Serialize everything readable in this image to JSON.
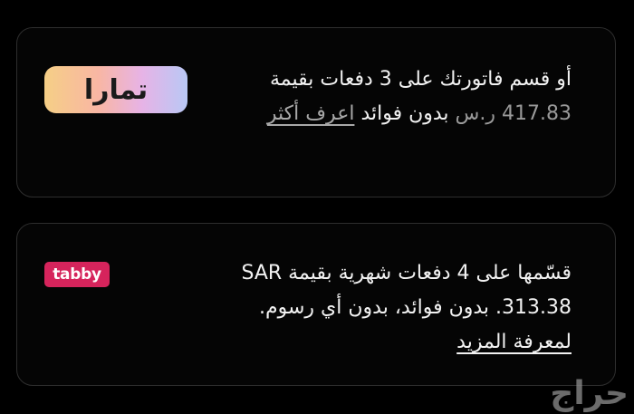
{
  "tamara": {
    "logo_text": "تمارا",
    "line1": "أو قسم فاتورتك على 3 دفعات بقيمة",
    "amount": "417.83 ر.س",
    "no_fees": "بدون فوائد",
    "learn_more": "اعرف أكثر"
  },
  "tabby": {
    "logo_text": "tabby",
    "line1": "قسّمها على 4 دفعات شهرية بقيمة SAR",
    "line2": "313.38. بدون فوائد، بدون أي رسوم.",
    "learn_more": "لمعرفة المزيد"
  },
  "watermark": {
    "text": "حراج"
  },
  "colors": {
    "background": "#000000",
    "card_border": "#2e2e2e",
    "tabby_brand": "#d6245c",
    "text_primary": "#f2f2f2",
    "text_muted": "#9a9a9a"
  }
}
